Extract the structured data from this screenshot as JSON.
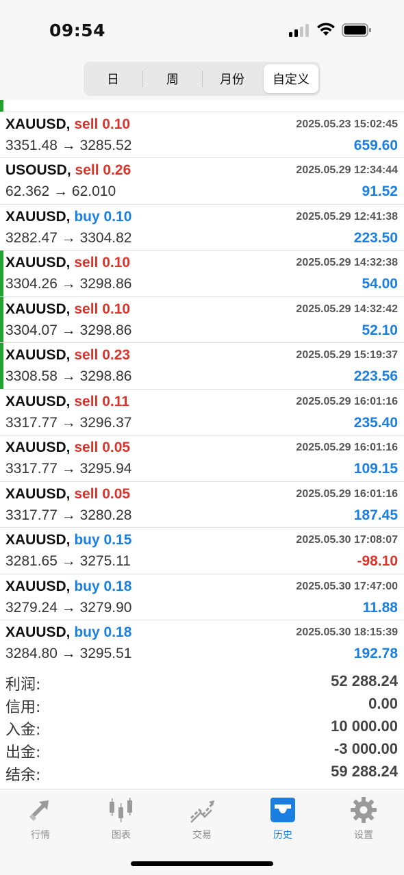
{
  "status": {
    "time": "09:54"
  },
  "tabs_period": [
    {
      "label": "日"
    },
    {
      "label": "周"
    },
    {
      "label": "月份"
    },
    {
      "label": "自定义"
    }
  ],
  "rows": [
    {
      "symbol": "XAUUSD,",
      "side": "sell",
      "lots": "0.10",
      "side_lots": "sell 0.10",
      "datetime": "2025.05.23 15:02:45",
      "prices": "3351.48 → 3285.52",
      "profit": "659.60"
    },
    {
      "symbol": "USOUSD,",
      "side": "sell",
      "lots": "0.26",
      "side_lots": "sell 0.26",
      "datetime": "2025.05.29 12:34:44",
      "prices": "62.362 → 62.010",
      "profit": "91.52"
    },
    {
      "symbol": "XAUUSD,",
      "side": "buy",
      "lots": "0.10",
      "side_lots": "buy 0.10",
      "datetime": "2025.05.29 12:41:38",
      "prices": "3282.47 → 3304.82",
      "profit": "223.50"
    },
    {
      "symbol": "XAUUSD,",
      "side": "sell",
      "lots": "0.10",
      "side_lots": "sell 0.10",
      "datetime": "2025.05.29 14:32:38",
      "prices": "3304.26 → 3298.86",
      "profit": "54.00"
    },
    {
      "symbol": "XAUUSD,",
      "side": "sell",
      "lots": "0.10",
      "side_lots": "sell 0.10",
      "datetime": "2025.05.29 14:32:42",
      "prices": "3304.07 → 3298.86",
      "profit": "52.10"
    },
    {
      "symbol": "XAUUSD,",
      "side": "sell",
      "lots": "0.23",
      "side_lots": "sell 0.23",
      "datetime": "2025.05.29 15:19:37",
      "prices": "3308.58 → 3298.86",
      "profit": "223.56"
    },
    {
      "symbol": "XAUUSD,",
      "side": "sell",
      "lots": "0.11",
      "side_lots": "sell 0.11",
      "datetime": "2025.05.29 16:01:16",
      "prices": "3317.77 → 3296.37",
      "profit": "235.40"
    },
    {
      "symbol": "XAUUSD,",
      "side": "sell",
      "lots": "0.05",
      "side_lots": "sell 0.05",
      "datetime": "2025.05.29 16:01:16",
      "prices": "3317.77 → 3295.94",
      "profit": "109.15"
    },
    {
      "symbol": "XAUUSD,",
      "side": "sell",
      "lots": "0.05",
      "side_lots": "sell 0.05",
      "datetime": "2025.05.29 16:01:16",
      "prices": "3317.77 → 3280.28",
      "profit": "187.45"
    },
    {
      "symbol": "XAUUSD,",
      "side": "buy",
      "lots": "0.15",
      "side_lots": "buy 0.15",
      "datetime": "2025.05.30 17:08:07",
      "prices": "3281.65 → 3275.11",
      "profit": "-98.10"
    },
    {
      "symbol": "XAUUSD,",
      "side": "buy",
      "lots": "0.18",
      "side_lots": "buy 0.18",
      "datetime": "2025.05.30 17:47:00",
      "prices": "3279.24 → 3279.90",
      "profit": "11.88"
    },
    {
      "symbol": "XAUUSD,",
      "side": "buy",
      "lots": "0.18",
      "side_lots": "buy 0.18",
      "datetime": "2025.05.30 18:15:39",
      "prices": "3284.80 → 3295.51",
      "profit": "192.78"
    }
  ],
  "summary": {
    "profit_label": "利润:",
    "profit_value": "52 288.24",
    "credit_label": "信用:",
    "credit_value": "0.00",
    "deposit_label": "入金:",
    "deposit_value": "10 000.00",
    "withdraw_label": "出金:",
    "withdraw_value": "-3 000.00",
    "balance_label": "结余:",
    "balance_value": "59 288.24"
  },
  "tabbar": {
    "quotes": "行情",
    "charts": "图表",
    "trade": "交易",
    "history": "历史",
    "settings": "设置"
  },
  "colors": {
    "sell": "#d9342b",
    "buy": "#1a7fe0",
    "accent": "#1a7fe0",
    "marker": "#1fa32c"
  }
}
